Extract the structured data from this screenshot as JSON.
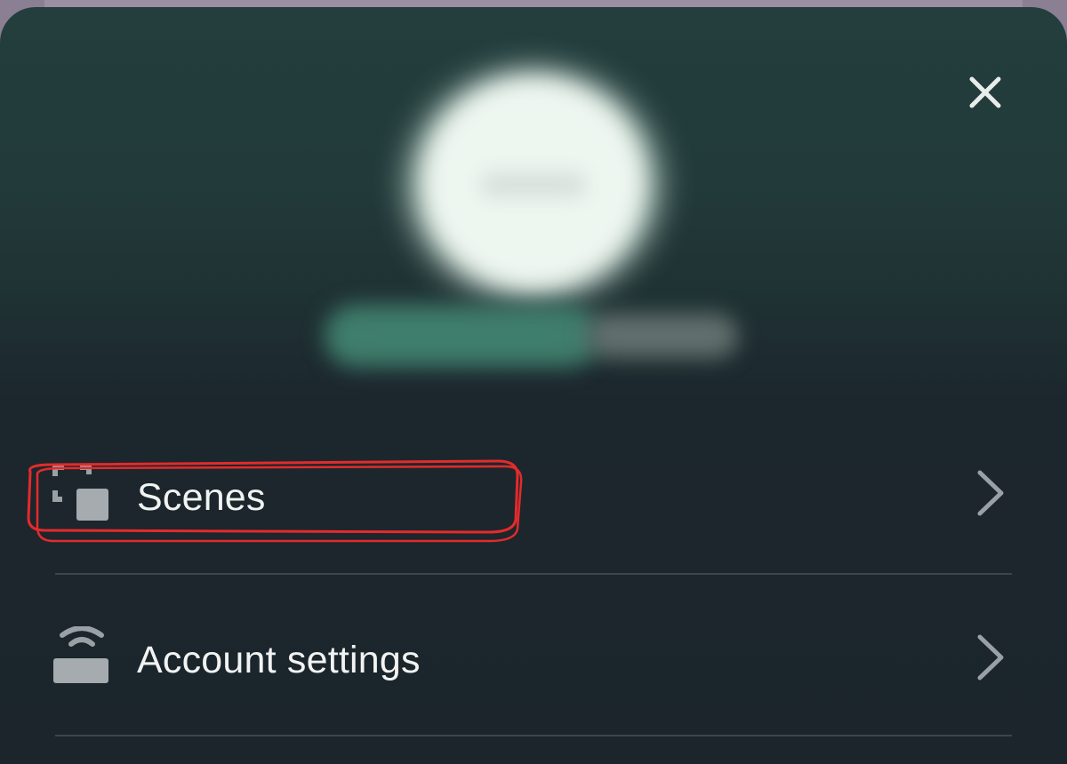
{
  "header": {
    "close_icon": "close-icon"
  },
  "profile": {
    "avatar": "blurred-avatar",
    "name_blurred": true
  },
  "menu": {
    "items": [
      {
        "label": "Scenes",
        "icon": "scenes-icon",
        "chevron": "chevron-right-icon"
      },
      {
        "label": "Account settings",
        "icon": "router-icon",
        "chevron": "chevron-right-icon"
      }
    ]
  },
  "colors": {
    "sheet_bg": "#1b252b",
    "text": "#f1f3f2",
    "icon_gray": "#9aa1a5",
    "highlight_red": "#e32b2b"
  }
}
